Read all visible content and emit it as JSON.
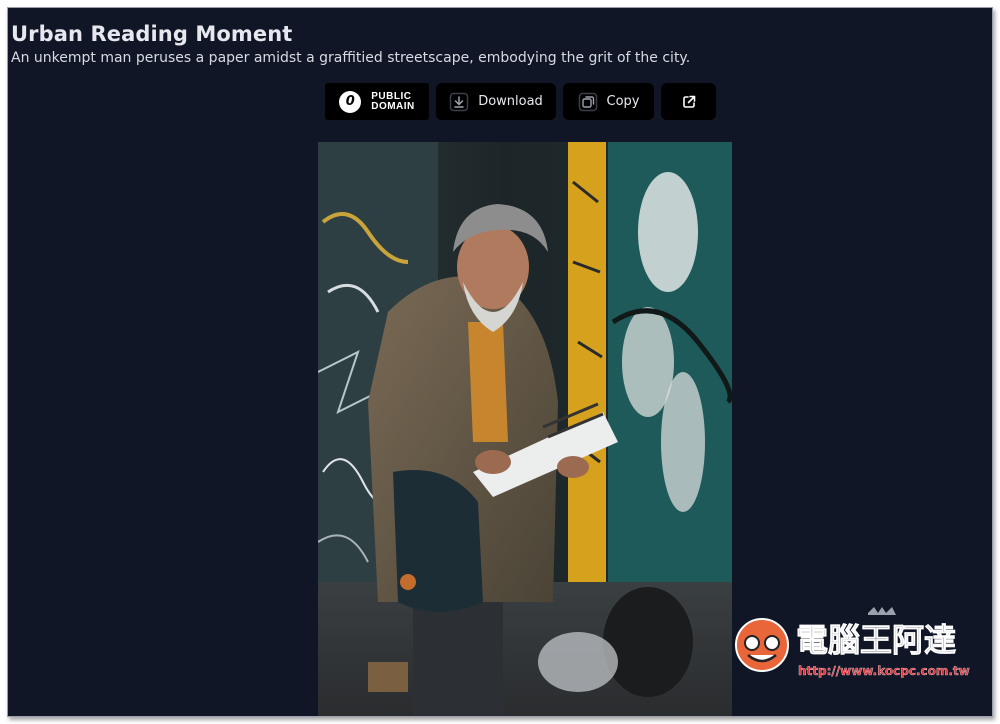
{
  "page": {
    "title": "Urban Reading Moment",
    "description": "An unkempt man peruses a paper amidst a graffitied streetscape, embodying the grit of the city."
  },
  "toolbar": {
    "public_domain_line1": "PUBLIC",
    "public_domain_line2": "DOMAIN",
    "public_domain_icon_glyph": "0",
    "download_label": "Download",
    "copy_label": "Copy",
    "icons": {
      "public_domain": "public-domain-icon",
      "download": "download-icon",
      "copy": "copy-icon",
      "external": "external-link-icon"
    }
  },
  "image": {
    "alt": "Urban Reading Moment"
  },
  "watermark": {
    "name": "電腦王阿達",
    "url": "http://www.kocpc.com.tw"
  },
  "colors": {
    "page_background": "#111626",
    "button_background": "#000000",
    "text_primary": "#e6e8ee",
    "watermark_red": "#e0323a"
  }
}
